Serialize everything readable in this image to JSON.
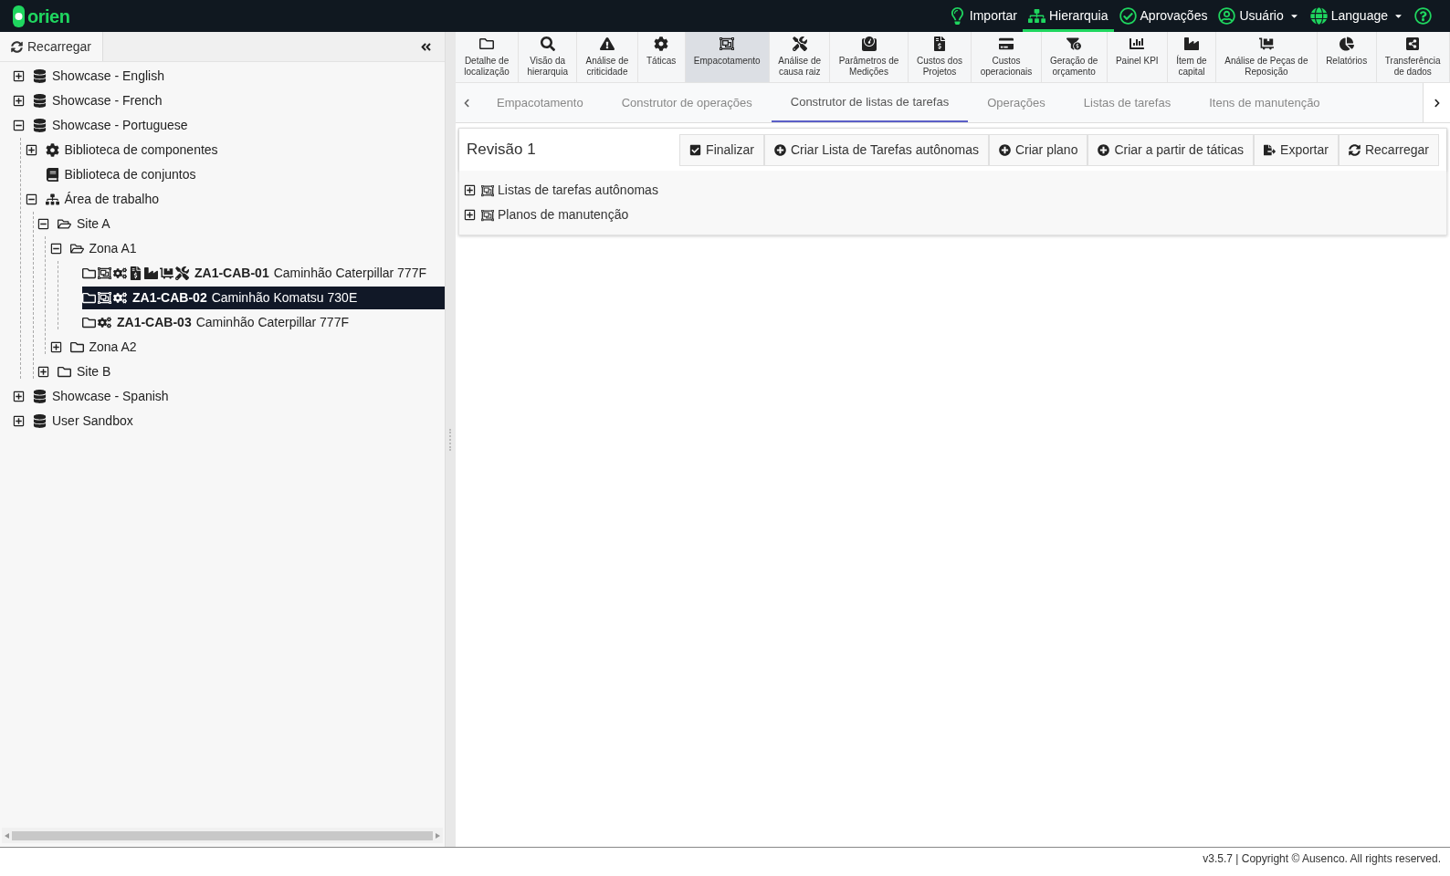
{
  "brand": {
    "name": "orien"
  },
  "top_nav": [
    {
      "label": "Importar",
      "kind": "bulb",
      "selected": false,
      "dropdown": false
    },
    {
      "label": "Hierarquia",
      "kind": "sitemap",
      "selected": true,
      "dropdown": false
    },
    {
      "label": "Aprovações",
      "kind": "check",
      "selected": false,
      "dropdown": false
    },
    {
      "label": "Usuário",
      "kind": "user",
      "selected": false,
      "dropdown": true
    },
    {
      "label": "Language",
      "kind": "globe",
      "selected": false,
      "dropdown": true
    },
    {
      "kind": "help",
      "selected": false,
      "dropdown": false
    }
  ],
  "sidebar": {
    "reload_label": "Recarregar",
    "tree": [
      {
        "label": "Showcase - English",
        "icons": [
          {
            "kind": "database"
          }
        ],
        "expanded": false,
        "selected": false
      },
      {
        "label": "Showcase - French",
        "icons": [
          {
            "kind": "database"
          }
        ],
        "expanded": false,
        "selected": false
      },
      {
        "label": "Showcase - Portuguese",
        "icons": [
          {
            "kind": "database"
          }
        ],
        "expanded": true,
        "selected": false,
        "children": [
          {
            "label": "Biblioteca de componentes",
            "icons": [
              {
                "kind": "gear"
              }
            ],
            "expanded": false,
            "selected": false
          },
          {
            "label": "Biblioteca de conjuntos",
            "icons": [
              {
                "kind": "book"
              }
            ],
            "selected": false
          },
          {
            "label": "Área de trabalho",
            "icons": [
              {
                "kind": "sitemap"
              }
            ],
            "expanded": true,
            "selected": false,
            "children": [
              {
                "label": "Site A",
                "icons": [
                  {
                    "kind": "folder-open"
                  }
                ],
                "expanded": true,
                "selected": false,
                "children": [
                  {
                    "label": "Zona A1",
                    "icons": [
                      {
                        "kind": "folder-open"
                      }
                    ],
                    "expanded": true,
                    "selected": false,
                    "children": [
                      {
                        "code": "ZA1-CAB-01",
                        "label": "Caminhão Caterpillar 777F",
                        "icons": [
                          {
                            "kind": "folder"
                          },
                          {
                            "kind": "object-group"
                          },
                          {
                            "kind": "gears"
                          },
                          {
                            "kind": "file-dollar"
                          },
                          {
                            "kind": "industry"
                          },
                          {
                            "kind": "dolly"
                          },
                          {
                            "kind": "tools"
                          }
                        ],
                        "selected": false
                      },
                      {
                        "code": "ZA1-CAB-02",
                        "label": "Caminhão Komatsu 730E",
                        "icons": [
                          {
                            "kind": "folder"
                          },
                          {
                            "kind": "object-group"
                          },
                          {
                            "kind": "gears"
                          }
                        ],
                        "selected": true
                      },
                      {
                        "code": "ZA1-CAB-03",
                        "label": "Caminhão Caterpillar 777F",
                        "icons": [
                          {
                            "kind": "folder"
                          },
                          {
                            "kind": "gears"
                          }
                        ],
                        "selected": false
                      }
                    ]
                  },
                  {
                    "label": "Zona A2",
                    "icons": [
                      {
                        "kind": "folder"
                      }
                    ],
                    "expanded": false,
                    "selected": false
                  }
                ]
              },
              {
                "label": "Site B",
                "icons": [
                  {
                    "kind": "folder"
                  }
                ],
                "expanded": false,
                "selected": false
              }
            ]
          }
        ]
      },
      {
        "label": "Showcase - Spanish",
        "icons": [
          {
            "kind": "database"
          }
        ],
        "expanded": false,
        "selected": false
      },
      {
        "label": "User Sandbox",
        "icons": [
          {
            "kind": "database"
          }
        ],
        "expanded": false,
        "selected": false
      }
    ]
  },
  "modules": [
    {
      "label": "Detalhe de\nlocalização",
      "kind": "folder",
      "selected": false
    },
    {
      "label": "Visão da\nhierarquia",
      "kind": "search",
      "selected": false
    },
    {
      "label": "Análise de\ncriticidade",
      "kind": "warning",
      "selected": false
    },
    {
      "label": "Táticas",
      "kind": "gear",
      "selected": false
    },
    {
      "label": "Empacotamento",
      "kind": "object-group",
      "selected": true
    },
    {
      "label": "Análise de\ncausa raiz",
      "kind": "tools",
      "selected": false
    },
    {
      "label": "Parâmetros de\nMedições",
      "kind": "weight",
      "selected": false
    },
    {
      "label": "Custos dos\nProjetos",
      "kind": "file-dollar",
      "selected": false
    },
    {
      "label": "Custos\noperacionais",
      "kind": "card",
      "selected": false
    },
    {
      "label": "Geração de\norçamento",
      "kind": "funnel-dollar",
      "selected": false
    },
    {
      "label": "Painel KPI",
      "kind": "chart-bar",
      "selected": false
    },
    {
      "label": "Ítem de\ncapital",
      "kind": "industry",
      "selected": false
    },
    {
      "label": "Análise de Peças de\nReposição",
      "kind": "dolly",
      "selected": false
    },
    {
      "label": "Relatórios",
      "kind": "chart-pie",
      "selected": false
    },
    {
      "label": "Transferência\nde dados",
      "kind": "share",
      "selected": false
    }
  ],
  "tabs": [
    {
      "label": "Empacotamento",
      "selected": false
    },
    {
      "label": "Construtor de operações",
      "selected": false
    },
    {
      "label": "Construtor de listas de tarefas",
      "selected": true
    },
    {
      "label": "Operações",
      "selected": false
    },
    {
      "label": "Listas de tarefas",
      "selected": false
    },
    {
      "label": "Itens de manutenção",
      "selected": false
    }
  ],
  "panel": {
    "title": "Revisão 1",
    "buttons": [
      {
        "label": "Finalizar",
        "kind": "check-square"
      },
      {
        "label": "Criar Lista de Tarefas autônomas",
        "kind": "plus"
      },
      {
        "label": "Criar plano",
        "kind": "plus"
      },
      {
        "label": "Criar a partir de táticas",
        "kind": "plus"
      },
      {
        "label": "Exportar",
        "kind": "export"
      },
      {
        "label": "Recarregar",
        "kind": "sync"
      }
    ],
    "tree": [
      {
        "label": "Listas de tarefas autônomas",
        "icons": [
          {
            "kind": "object-group"
          }
        ],
        "expanded": false,
        "selected": false
      },
      {
        "label": "Planos de manutenção",
        "icons": [
          {
            "kind": "object-group"
          }
        ],
        "expanded": false,
        "selected": false
      }
    ]
  },
  "footer": "v3.5.7 | Copyright © Ausenco. All rights reserved."
}
